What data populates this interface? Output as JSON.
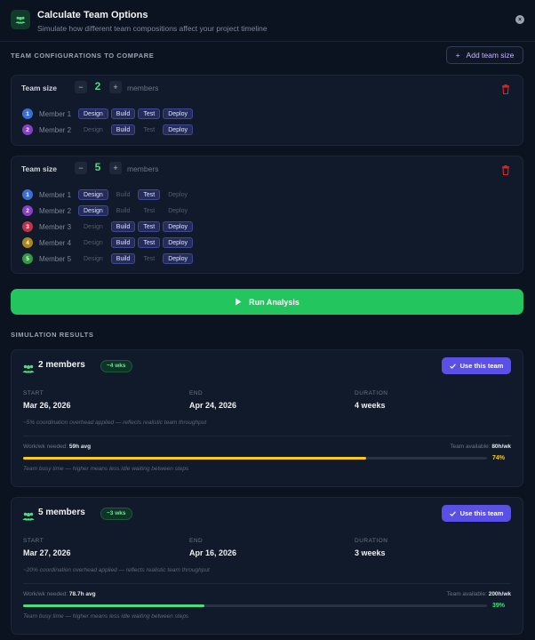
{
  "header": {
    "title": "Calculate Team Options",
    "subtitle": "Simulate how different team compositions affect your project timeline",
    "close_label": "×"
  },
  "configs_section": {
    "title": "TEAM CONFIGURATIONS TO COMPARE",
    "add_button": "Add team size",
    "add_icon": "+"
  },
  "configs": [
    {
      "label": "Team size",
      "size": "2",
      "members_label": "members",
      "members": [
        {
          "num": "1",
          "name": "Member 1",
          "color": "#3b6fd4",
          "skills": [
            [
              "Design",
              true
            ],
            [
              "Build",
              true
            ],
            [
              "Test",
              true
            ],
            [
              "Deploy",
              true
            ]
          ]
        },
        {
          "num": "2",
          "name": "Member 2",
          "color": "#8a3fc9",
          "skills": [
            [
              "Design",
              false
            ],
            [
              "Build",
              true
            ],
            [
              "Test",
              false
            ],
            [
              "Deploy",
              true
            ]
          ]
        }
      ]
    },
    {
      "label": "Team size",
      "size": "5",
      "members_label": "members",
      "members": [
        {
          "num": "1",
          "name": "Member 1",
          "color": "#3b6fd4",
          "skills": [
            [
              "Design",
              true
            ],
            [
              "Build",
              false
            ],
            [
              "Test",
              true
            ],
            [
              "Deploy",
              false
            ]
          ]
        },
        {
          "num": "2",
          "name": "Member 2",
          "color": "#8a3fc9",
          "skills": [
            [
              "Design",
              true
            ],
            [
              "Build",
              false
            ],
            [
              "Test",
              false
            ],
            [
              "Deploy",
              false
            ]
          ]
        },
        {
          "num": "3",
          "name": "Member 3",
          "color": "#c2334a",
          "skills": [
            [
              "Design",
              false
            ],
            [
              "Build",
              true
            ],
            [
              "Test",
              true
            ],
            [
              "Deploy",
              true
            ]
          ]
        },
        {
          "num": "4",
          "name": "Member 4",
          "color": "#a8871f",
          "skills": [
            [
              "Design",
              false
            ],
            [
              "Build",
              true
            ],
            [
              "Test",
              true
            ],
            [
              "Deploy",
              true
            ]
          ]
        },
        {
          "num": "5",
          "name": "Member 5",
          "color": "#2f9e3e",
          "skills": [
            [
              "Design",
              false
            ],
            [
              "Build",
              true
            ],
            [
              "Test",
              false
            ],
            [
              "Deploy",
              true
            ]
          ]
        }
      ]
    }
  ],
  "run_button": "Run Analysis",
  "results_section": {
    "title": "SIMULATION RESULTS"
  },
  "results": [
    {
      "title": "2 members",
      "badge": "~4 wks",
      "use_button": "Use this team",
      "start_label": "START",
      "start": "Mar 26, 2026",
      "end_label": "END",
      "end": "Apr 24, 2026",
      "duration_label": "DURATION",
      "duration": "4 weeks",
      "note": "~5% coordination overhead applied — reflects realistic team throughput",
      "work_label": "Work/wk needed:",
      "work_value": "59h avg",
      "avail_label": "Team available:",
      "avail_value": "80h/wk",
      "busy_pct": 74,
      "busy_label": "74%",
      "bar_color": "#facc15",
      "bar_note": "Team busy time — higher means less idle waiting between steps"
    },
    {
      "title": "5 members",
      "badge": "~3 wks",
      "use_button": "Use this team",
      "start_label": "START",
      "start": "Mar 27, 2026",
      "end_label": "END",
      "end": "Apr 16, 2026",
      "duration_label": "DURATION",
      "duration": "3 weeks",
      "note": "~20% coordination overhead applied — reflects realistic team throughput",
      "work_label": "Work/wk needed:",
      "work_value": "78.7h avg",
      "avail_label": "Team available:",
      "avail_value": "200h/wk",
      "busy_pct": 39,
      "busy_label": "39%",
      "bar_color": "#4ade80",
      "bar_note": "Team busy time — higher means less idle waiting between steps"
    }
  ]
}
